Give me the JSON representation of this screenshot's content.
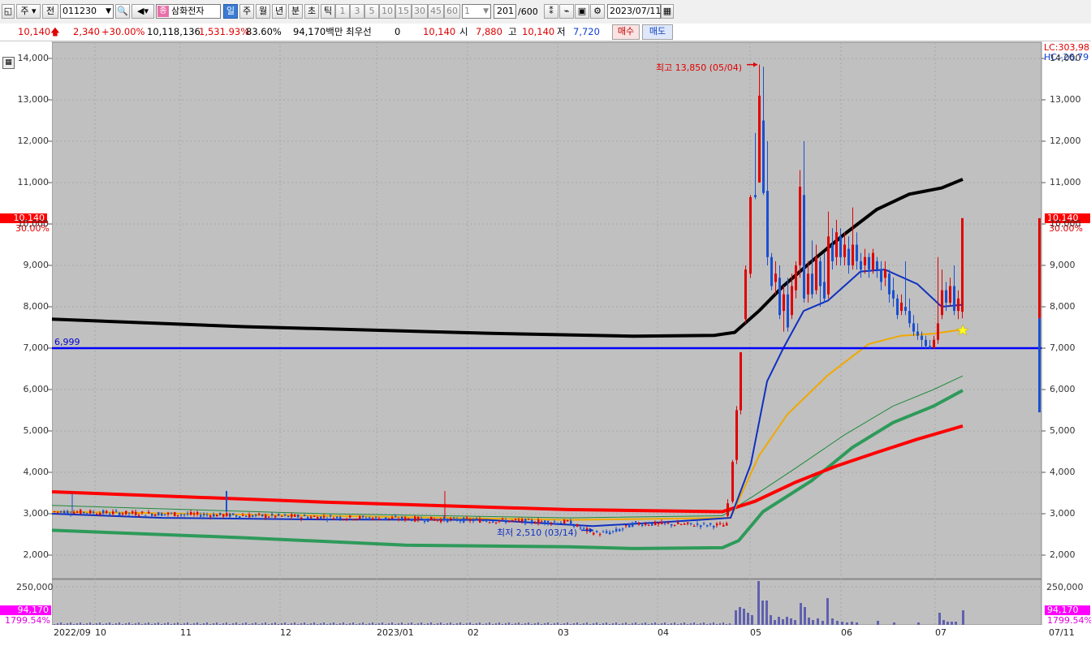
{
  "toolbar": {
    "period_button": "주",
    "market_button": "전",
    "code": "011230",
    "stock_name": "삼화전자",
    "stock_badge": "종",
    "periods": [
      "일",
      "주",
      "월",
      "년",
      "분",
      "초",
      "틱"
    ],
    "intervals": [
      "1",
      "3",
      "5",
      "10",
      "15",
      "30",
      "45",
      "60"
    ],
    "interval_value": "1",
    "count_value": "201",
    "count_total": "/600",
    "date": "2023/07/11"
  },
  "quote": {
    "price": "10,140",
    "change": "2,340",
    "change_pct": "+30.00%",
    "volume": "10,118,136",
    "volume_ratio": "1,531.93%",
    "turnover": "83.60%",
    "trade_value": "94,170백만",
    "best_bid_label": "최우선",
    "best_bid_value": "0",
    "price2": "10,140",
    "open_label": "시",
    "open": "7,880",
    "high_label": "고",
    "high": "10,140",
    "low_label": "저",
    "low": "7,720",
    "buy_button": "매수",
    "sell_button": "매도"
  },
  "chart": {
    "lc_label": "LC:303,98",
    "hc_label": "HC:-26,79",
    "price_tag": "10,140",
    "pct_tag": "30.00%",
    "hline_label": "6,999",
    "high_annotation": "최고 13,850 (05/04)",
    "low_annotation": "최저 2,510 (03/14)",
    "vol_tag": "94,170",
    "vol_pct_tag": "1799.54%",
    "vol_axis_label": "250,000",
    "colors": {
      "up": "#e00000",
      "down": "#1a50d0",
      "bg": "#c0c0c0",
      "hline": "#0000ff",
      "ma_black": "#000000",
      "ma_red": "#ff0000",
      "ma_green": "#2e9a5a",
      "ma_blue": "#1030c0",
      "ma_orange": "#f0a800"
    }
  },
  "chart_data": {
    "type": "candlestick",
    "y_ticks": [
      "14,000",
      "13,000",
      "12,000",
      "11,000",
      "10,000",
      "9,000",
      "8,000",
      "7,000",
      "6,000",
      "5,000",
      "4,000",
      "3,000",
      "2,000"
    ],
    "y_tick_values": [
      14000,
      13000,
      12000,
      11000,
      10000,
      9000,
      8000,
      7000,
      6000,
      5000,
      4000,
      3000,
      2000
    ],
    "ylim": [
      1750,
      14300
    ],
    "x_labels": [
      "2022/09",
      "10",
      "11",
      "12",
      "2023/01",
      "02",
      "03",
      "04",
      "05",
      "06",
      "07"
    ],
    "x_end_label": "07/11",
    "horizontal_line": 6999,
    "last_price": 10140,
    "period_high": {
      "value": 13850,
      "date": "05/04"
    },
    "period_low": {
      "value": 2510,
      "date": "03/14"
    },
    "grid": true
  }
}
